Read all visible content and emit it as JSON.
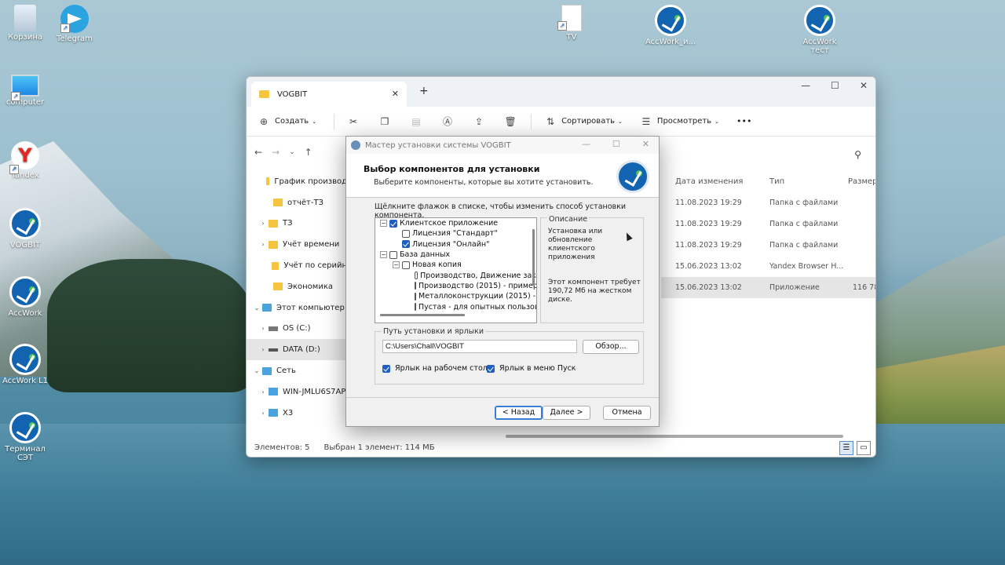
{
  "desktop": {
    "icons": [
      {
        "label": "Корзина"
      },
      {
        "label": "Telegram"
      },
      {
        "label": "computer"
      },
      {
        "label": "Yandex"
      },
      {
        "label": "VOGBIT"
      },
      {
        "label": "AccWork"
      },
      {
        "label": "AccWork L1"
      },
      {
        "label": "Терминал СЭТ"
      },
      {
        "label": "TV"
      },
      {
        "label": "AccWork_и..."
      },
      {
        "label": "AccWork тест"
      }
    ]
  },
  "explorer": {
    "tab_title": "VOGBIT",
    "toolbar": {
      "create": "Создать",
      "sort": "Сортировать",
      "view": "Просмотреть",
      "more": "•••"
    },
    "tree": [
      {
        "label": "График производ"
      },
      {
        "label": "отчёт-ТЗ"
      },
      {
        "label": "ТЗ"
      },
      {
        "label": "Учёт времени"
      },
      {
        "label": "Учёт по серийн"
      },
      {
        "label": "Экономика"
      },
      {
        "label": "Этот компьютер"
      },
      {
        "label": "OS (C:)"
      },
      {
        "label": "DATA (D:)"
      },
      {
        "label": "Сеть"
      },
      {
        "label": "WIN-JMLU6S7AP"
      },
      {
        "label": "X3"
      }
    ],
    "columns": {
      "date": "Дата изменения",
      "type": "Тип",
      "size": "Размер"
    },
    "rows": [
      {
        "date": "11.08.2023 19:29",
        "type": "Папка с файлами",
        "size": ""
      },
      {
        "date": "11.08.2023 19:29",
        "type": "Папка с файлами",
        "size": ""
      },
      {
        "date": "11.08.2023 19:29",
        "type": "Папка с файлами",
        "size": ""
      },
      {
        "date": "15.06.2023 13:02",
        "type": "Yandex Browser H...",
        "size": ""
      },
      {
        "date": "15.06.2023 13:02",
        "type": "Приложение",
        "size": "116 78"
      }
    ],
    "status": {
      "count": "Элементов: 5",
      "selected": "Выбран 1 элемент: 114 МБ"
    }
  },
  "dialog": {
    "title": "Мастер установки системы VOGBIT",
    "heading": "Выбор компонентов для установки",
    "subheading": "Выберите компоненты, которые вы хотите установить.",
    "instruction": "Щёлкните флажок в списке, чтобы изменить способ установки компонента.",
    "components": [
      {
        "label": "Клиентское приложение",
        "checked": true
      },
      {
        "label": "Лицензия \"Стандарт\"",
        "checked": false
      },
      {
        "label": "Лицензия \"Онлайн\"",
        "checked": true
      },
      {
        "label": "База данных",
        "checked": false
      },
      {
        "label": "Новая копия",
        "checked": false
      },
      {
        "label": "Производство, Движение зак",
        "checked": false
      },
      {
        "label": "Производство (2015) - пример",
        "checked": false
      },
      {
        "label": "Металлоконструкции (2015) - г",
        "checked": false
      },
      {
        "label": "Пустая - для опытных пользов",
        "checked": false
      }
    ],
    "description_caption": "Описание",
    "description_text": "Установка или обновление клиентского приложения",
    "description_size": "Этот компонент требует 190,72 Мб на жестком диске.",
    "path_caption": "Путь установки и ярлыки",
    "path_value": "C:\\Users\\Chall\\VOGBIT",
    "browse": "Обзор...",
    "shortcut_desktop": "Ярлык на рабочем столе",
    "shortcut_start": "Ярлык в меню Пуск",
    "back": "< Назад",
    "next": "Далее >",
    "cancel": "Отмена"
  }
}
